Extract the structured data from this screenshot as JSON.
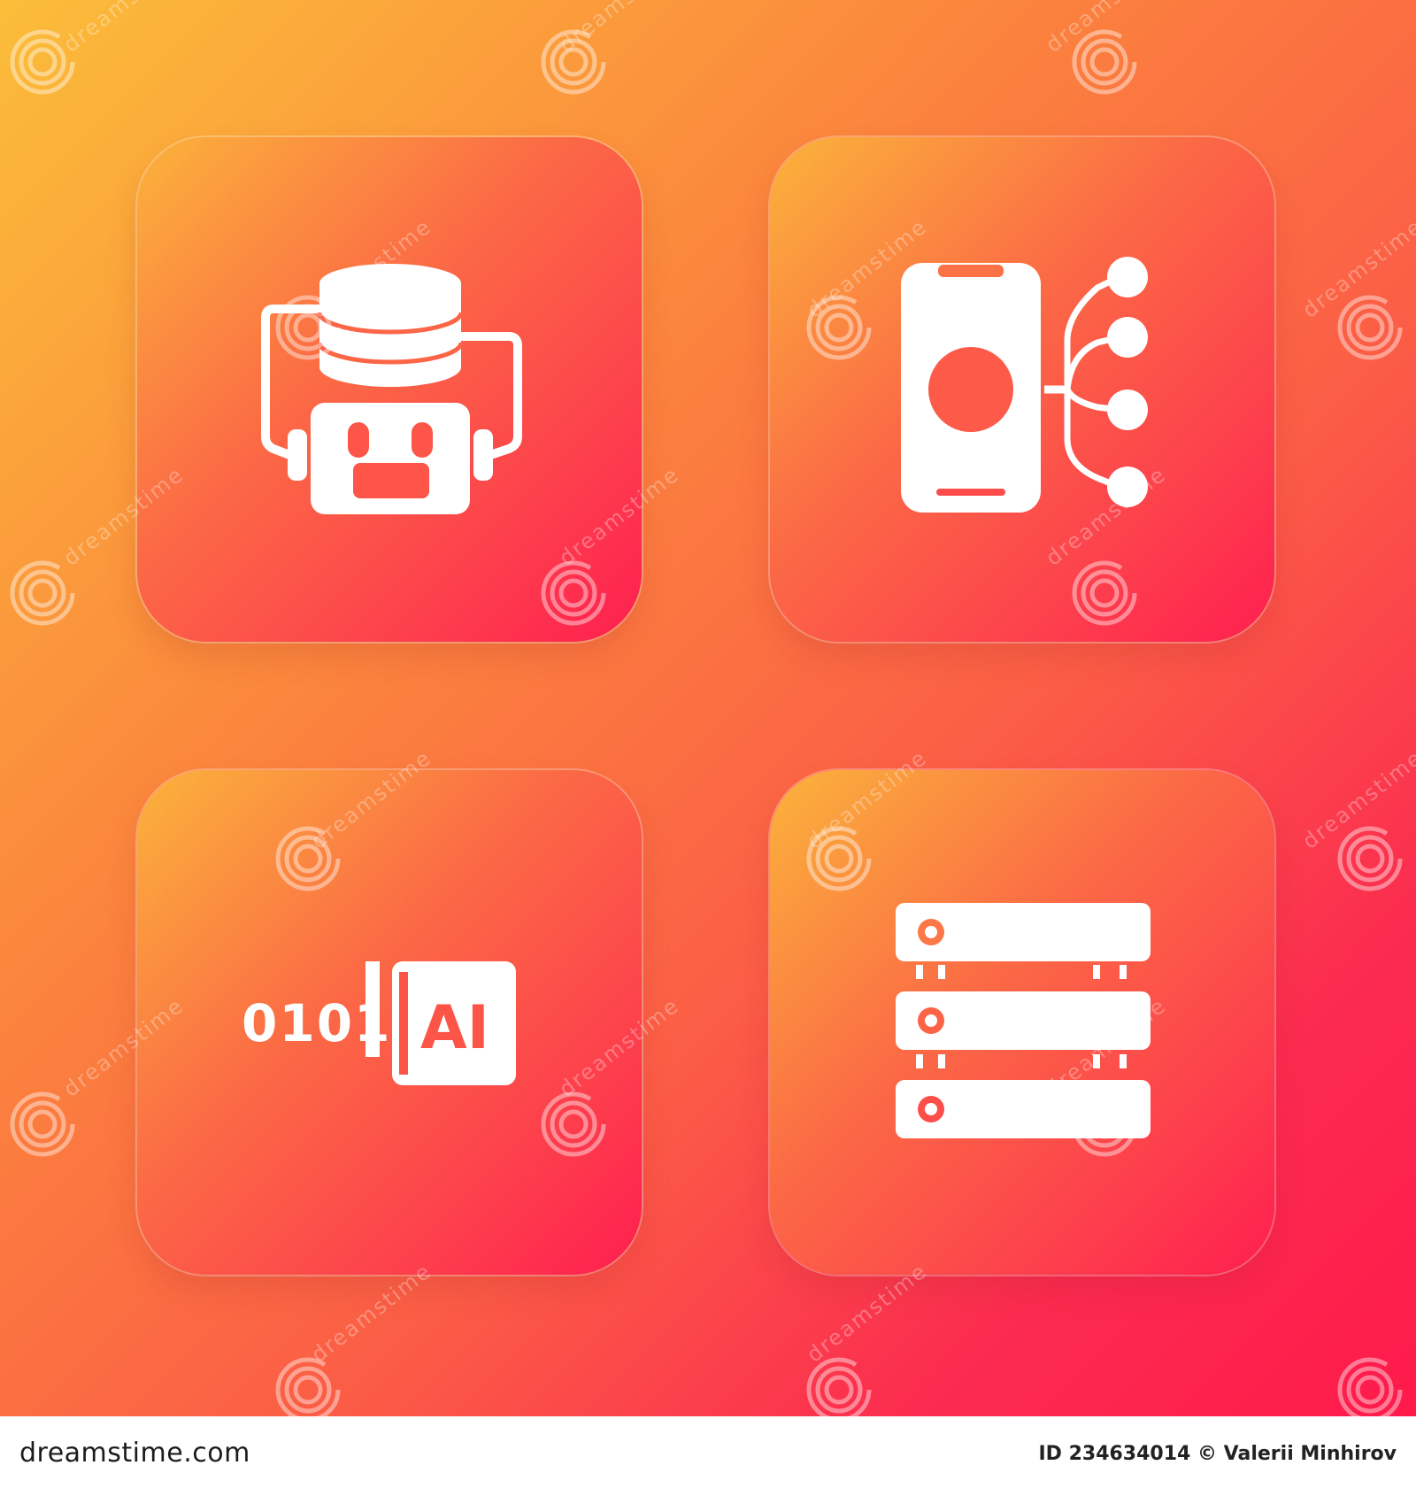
{
  "tiles": [
    {
      "icon": "robot-database-icon"
    },
    {
      "icon": "smartphone-network-icon"
    },
    {
      "icon": "binary-ai-chip-icon",
      "binary_text": "0101",
      "chip_text": "AI"
    },
    {
      "icon": "server-rack-icon"
    }
  ],
  "colors": {
    "background_start": "#fbbd3a",
    "background_end": "#ff1a4b",
    "icon_fill": "#ffffff"
  },
  "watermark": {
    "brand_text": "dreamstime"
  },
  "footer": {
    "site_label": "dreamstime.com",
    "id_label": "ID 234634014",
    "credit_label": "© Valerii Minhirov"
  }
}
